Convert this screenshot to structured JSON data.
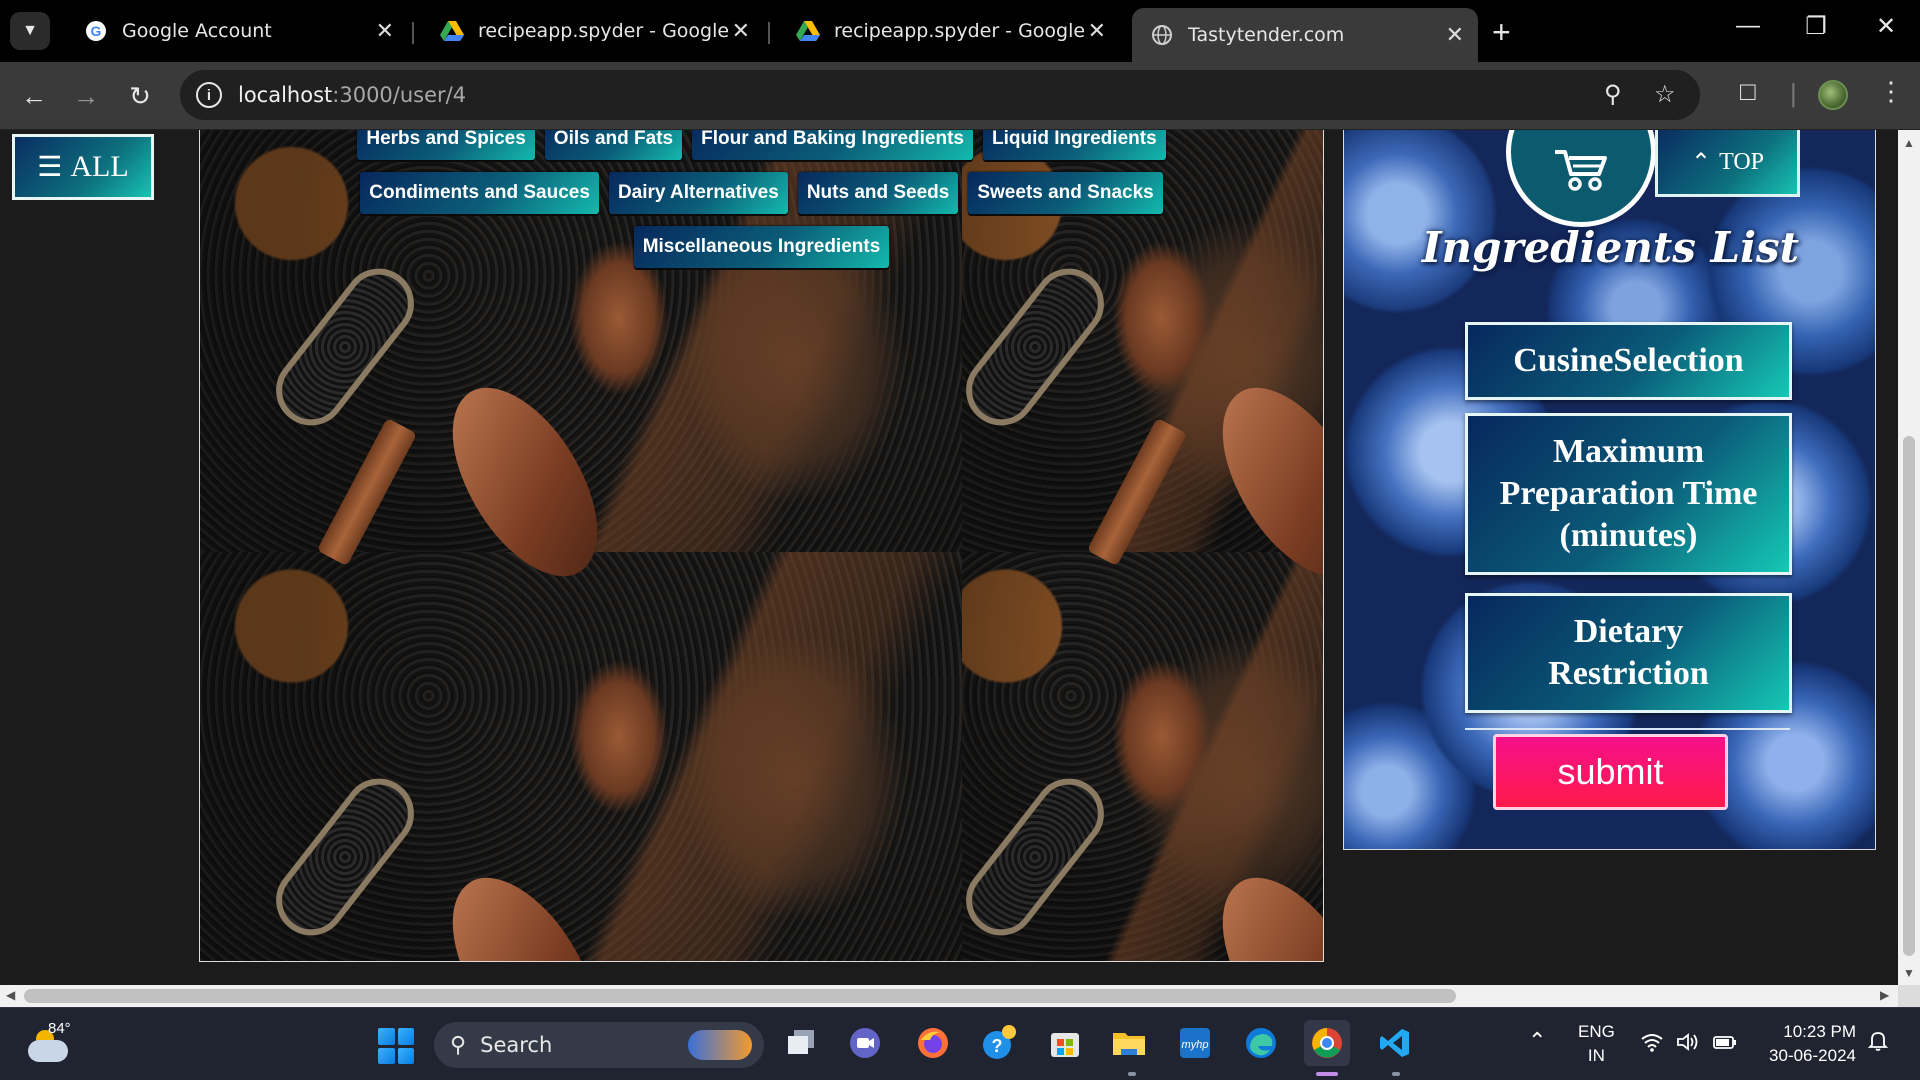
{
  "browser": {
    "tabs": [
      {
        "title": "Google Account",
        "favicon": "google-icon",
        "active": false
      },
      {
        "title": "recipeapp.spyder - Google Drive",
        "favicon": "drive-icon",
        "active": false
      },
      {
        "title": "recipeapp.spyder - Google Drive",
        "favicon": "drive-icon",
        "active": false
      },
      {
        "title": "Tastytender.com",
        "favicon": "globe-icon",
        "active": true
      }
    ],
    "url_host": "localhost",
    "url_path": ":3000/user/4"
  },
  "page": {
    "all_button": "ALL",
    "categories_row1": [
      "Herbs and Spices",
      "Oils and Fats",
      "Flour and Baking Ingredients",
      "Liquid Ingredients"
    ],
    "categories_row2": [
      "Condiments and Sauces",
      "Dairy Alternatives",
      "Nuts and Seeds",
      "Sweets and Snacks"
    ],
    "categories_row3": [
      "Miscellaneous Ingredients"
    ],
    "side": {
      "top_button": "TOP",
      "title": "Ingredients List",
      "cuisine_button": "CusineSelection",
      "prep_time_button": "Maximum Preparation Time (minutes)",
      "dietary_button": "Dietary Restriction",
      "submit_button": "submit"
    }
  },
  "taskbar": {
    "temperature": "84°",
    "search_placeholder": "Search",
    "language": "ENG",
    "region": "IN",
    "time": "10:23 PM",
    "date": "30-06-2024"
  },
  "colors": {
    "accent_teal": "#14b9ad",
    "accent_navy": "#07285d",
    "submit_pink": "#f5108a"
  }
}
